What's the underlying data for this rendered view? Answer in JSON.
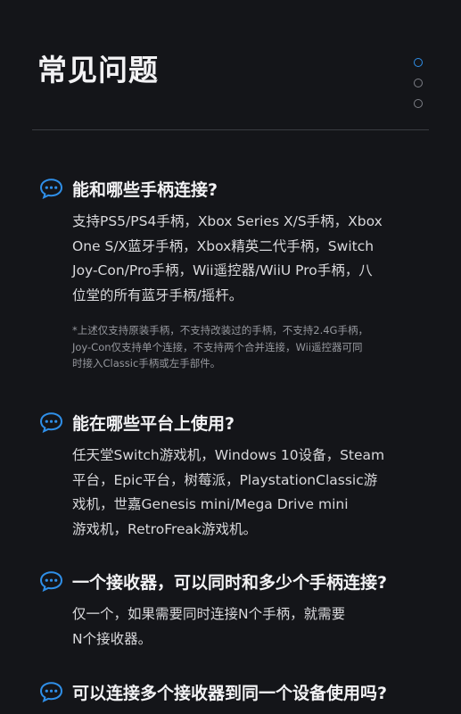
{
  "page": {
    "title": "常见问题"
  },
  "pager": {
    "count": 3,
    "active_index": 0,
    "active_color": "#2f8fe8"
  },
  "faqs": [
    {
      "icon": "chat-bubble-icon",
      "question": "能和哪些手柄连接?",
      "answer_lines": [
        "支持PS5/PS4手柄，Xbox Series X/S手柄，Xbox",
        "One S/X蓝牙手柄，Xbox精英二代手柄，Switch",
        "Joy-Con/Pro手柄，Wii遥控器/WiiU Pro手柄，八",
        "位堂的所有蓝牙手柄/摇杆。"
      ],
      "note_lines": [
        "*上述仅支持原装手柄，不支持改装过的手柄，不支持2.4G手柄，",
        "Joy-Con仅支持单个连接，不支持两个合并连接，Wii遥控器可同",
        "时接入Classic手柄或左手部件。"
      ]
    },
    {
      "icon": "chat-bubble-icon",
      "question": "能在哪些平台上使用?",
      "answer_lines": [
        "任天堂Switch游戏机，Windows 10设备，Steam",
        "平台，Epic平台，树莓派，PlaystationClassic游",
        "戏机，世嘉Genesis mini/Mega Drive mini",
        "游戏机，RetroFreak游戏机。"
      ]
    },
    {
      "icon": "chat-bubble-icon",
      "question": "一个接收器，可以同时和多少个手柄连接?",
      "answer_lines": [
        "仅一个，如果需要同时连接N个手柄，就需要",
        "N个接收器。"
      ]
    },
    {
      "icon": "chat-bubble-icon",
      "question": "可以连接多个接收器到同一个设备使用吗?"
    }
  ],
  "colors": {
    "background": "#141519",
    "accent": "#2f8fe8"
  }
}
